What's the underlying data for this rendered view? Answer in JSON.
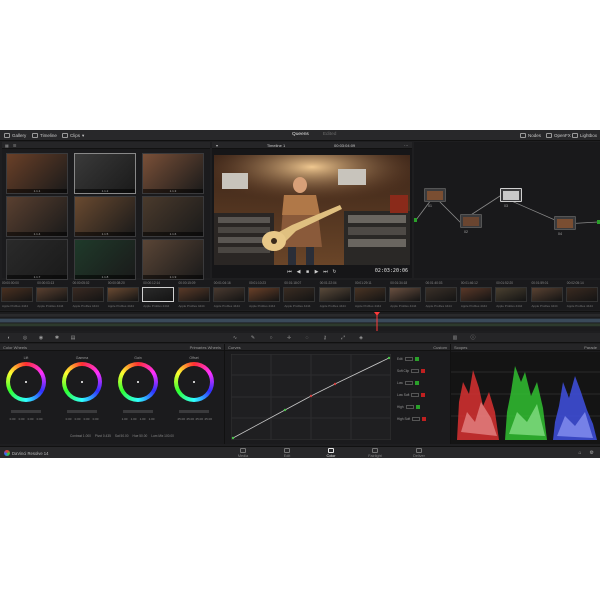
{
  "app": {
    "title": "DaVinci Resolve 14",
    "accent": "#ff3a3a"
  },
  "topbar": {
    "left": [
      {
        "label": "Gallery",
        "icon": "gallery-icon"
      },
      {
        "label": "Timeline",
        "icon": "timeline-icon"
      },
      {
        "label": "Clips",
        "icon": "clips-icon"
      }
    ],
    "center": {
      "active": "Queens",
      "inactive": "Edited"
    },
    "right": [
      {
        "label": "Nodes",
        "icon": "nodes-icon"
      },
      {
        "label": "OpenFX",
        "icon": "openfx-icon"
      },
      {
        "label": "Lightbox",
        "icon": "lightbox-icon"
      }
    ]
  },
  "viewer": {
    "clip_name": "Timeline 1",
    "timecode_top": "00:03:04:09",
    "timecode_main": "02:03:20:06"
  },
  "gallery": {
    "stills": [
      "1.1.1",
      "1.1.2",
      "1.1.3",
      "1.1.4",
      "1.1.5",
      "1.1.6",
      "1.1.7",
      "1.1.8",
      "1.1.9"
    ]
  },
  "nodes": {
    "items": [
      {
        "id": "01"
      },
      {
        "id": "02"
      },
      {
        "id": "03"
      },
      {
        "id": "04"
      }
    ]
  },
  "timeline": {
    "clips": [
      {
        "num": "01",
        "tc": "00:00:00:00",
        "name": "Apple ProRes 4444"
      },
      {
        "num": "02",
        "tc": "00:00:03:13",
        "name": "Apple ProRes 4444"
      },
      {
        "num": "03",
        "tc": "00:00:05:02",
        "name": "Apple ProRes 4444"
      },
      {
        "num": "04",
        "tc": "00:00:08:20",
        "name": "Apple ProRes 4444"
      },
      {
        "num": "05",
        "tc": "00:00:12:14",
        "name": "Apple ProRes 4444"
      },
      {
        "num": "06",
        "tc": "00:00:15:09",
        "name": "Apple ProRes 4444"
      },
      {
        "num": "07",
        "tc": "00:01:04:16",
        "name": "Apple ProRes 4444"
      },
      {
        "num": "08",
        "tc": "00:01:10:23",
        "name": "Apple ProRes 4444"
      },
      {
        "num": "09",
        "tc": "00:01:18:07",
        "name": "Apple ProRes 4444"
      },
      {
        "num": "10",
        "tc": "00:01:22:04",
        "name": "Apple ProRes 4444"
      },
      {
        "num": "11",
        "tc": "00:01:29:11",
        "name": "Apple ProRes 4444"
      },
      {
        "num": "12",
        "tc": "00:01:34:18",
        "name": "Apple ProRes 4444"
      },
      {
        "num": "13",
        "tc": "00:01:40:03",
        "name": "Apple ProRes 4444"
      },
      {
        "num": "14",
        "tc": "00:01:46:12",
        "name": "Apple ProRes 4444"
      },
      {
        "num": "15",
        "tc": "00:01:52:20",
        "name": "Apple ProRes 4444"
      },
      {
        "num": "16",
        "tc": "00:01:59:01",
        "name": "Apple ProRes 4444"
      },
      {
        "num": "17",
        "tc": "00:02:05:14",
        "name": "Apple ProRes 4444"
      }
    ]
  },
  "palette": {
    "wheels_title": "Color Wheels",
    "wheels_mode": "Primaries Wheels",
    "curves_title": "Curves",
    "custom_title": "Custom",
    "scopes_title": "Scopes",
    "scopes_mode": "Parade",
    "wheels": [
      {
        "name": "Lift",
        "values": [
          "0.00",
          "0.00",
          "0.00",
          "0.00"
        ]
      },
      {
        "name": "Gamma",
        "values": [
          "0.00",
          "0.00",
          "0.00",
          "0.00"
        ]
      },
      {
        "name": "Gain",
        "values": [
          "1.00",
          "1.00",
          "1.00",
          "1.00"
        ]
      },
      {
        "name": "Offset",
        "values": [
          "25.00",
          "25.00",
          "25.00",
          "25.00"
        ]
      }
    ],
    "footer": [
      "Contrast 1.000",
      "Pivot 0.435",
      "Sat 50.00",
      "Hue 50.00",
      "Lum Mix 100.00"
    ],
    "custom_rows": [
      "Edit",
      "Soft Clip",
      "Low",
      "Low Soft",
      "High",
      "High Soft"
    ]
  },
  "pages": [
    {
      "label": "Media",
      "icon": "media-icon",
      "active": false
    },
    {
      "label": "Edit",
      "icon": "edit-icon",
      "active": false
    },
    {
      "label": "Color",
      "icon": "color-icon",
      "active": true
    },
    {
      "label": "Fairlight",
      "icon": "fairlight-icon",
      "active": false
    },
    {
      "label": "Deliver",
      "icon": "deliver-icon",
      "active": false
    }
  ]
}
